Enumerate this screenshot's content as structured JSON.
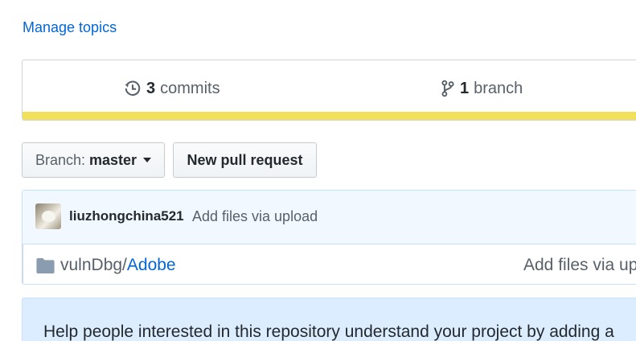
{
  "topics": {
    "manage_label": "Manage topics"
  },
  "summary": {
    "commits_count": "3",
    "commits_label": "commits",
    "branch_count": "1",
    "branch_label": "branch",
    "language_bar_color": "#f1e05a"
  },
  "toolbar": {
    "branch_prefix": "Branch:",
    "branch_name": "master",
    "new_pull_request_label": "New pull request"
  },
  "commit_tease": {
    "author": "liuzhongchina521",
    "message": "Add files via upload"
  },
  "files": [
    {
      "path_prefix": "vulnDbg/",
      "path_link": "Adobe",
      "message": "Add files via up"
    }
  ],
  "readme_prompt": {
    "text": "Help people interested in this repository understand your project by adding a"
  }
}
